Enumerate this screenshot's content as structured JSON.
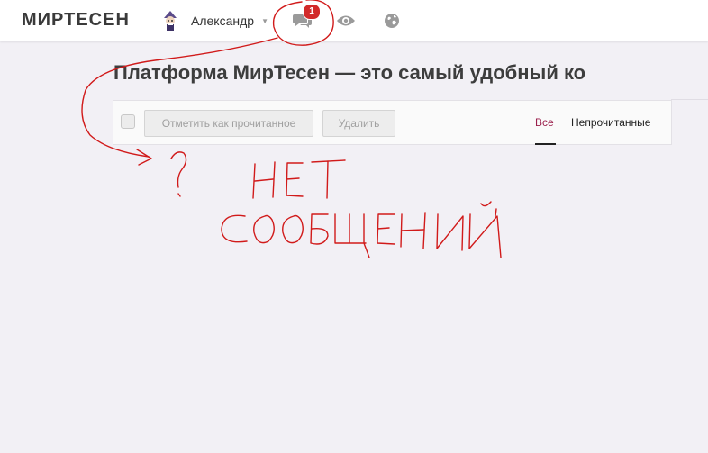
{
  "header": {
    "logo": "МИРТЕСЕН",
    "user_name": "Александр",
    "messages_badge": "1",
    "icons": [
      "avatar-icon",
      "chat-icon",
      "eye-icon",
      "globe-icon"
    ]
  },
  "page": {
    "title": "Платформа МирТесен — это самый удобный ко"
  },
  "toolbar": {
    "mark_read_label": "Отметить как прочитанное",
    "delete_label": "Удалить",
    "tab_all": "Все",
    "tab_unread": "Непрочитанные"
  },
  "annotation": {
    "question": "?",
    "line1": "НЕТ",
    "line2": "СООБЩЕНИЙ",
    "color": "#d11a1a"
  },
  "colors": {
    "background": "#f2f0f5",
    "active_tab": "#9b1f4c",
    "badge": "#d22a2a"
  }
}
